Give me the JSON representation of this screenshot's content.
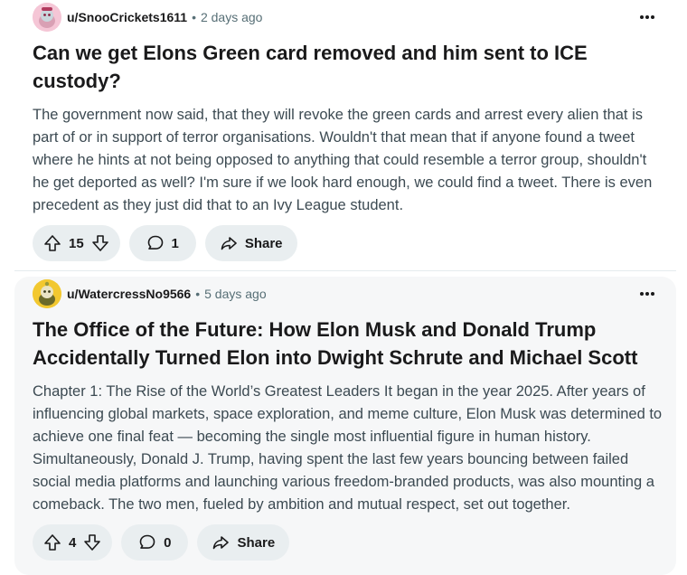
{
  "posts": [
    {
      "username": "u/SnooCrickets1611",
      "separator": "•",
      "time": "2 days ago",
      "title": "Can we get Elons Green card removed and him sent to ICE custody?",
      "body": "The government now said, that they will revoke the green cards and arrest every alien that is part of or in support of terror organisations. Wouldn't that mean that if anyone found a tweet where he hints at not being opposed to anything that could resemble a terror group, shouldn't he get deported as well? I'm sure if we look hard enough, we could find a tweet. There is even precedent as they just did that to an Ivy League student.",
      "votes": "15",
      "comments": "1",
      "share_label": "Share",
      "avatar_color": "#f5c6d6"
    },
    {
      "username": "u/WatercressNo9566",
      "separator": "•",
      "time": "5 days ago",
      "title": "The Office of the Future: How Elon Musk and Donald Trump Accidentally Turned Elon into Dwight Schrute and Michael Scott",
      "body": "Chapter 1: The Rise of the World’s Greatest Leaders It began in the year 2025. After years of influencing global markets, space exploration, and meme culture, Elon Musk was determined to achieve one final feat — becoming the single most influential figure in human history. Simultaneously, Donald J. Trump, having spent the last few years bouncing between failed social media platforms and launching various freedom-branded products, was also mounting a comeback. The two men, fueled by ambition and mutual respect, set out together.",
      "votes": "4",
      "comments": "0",
      "share_label": "Share",
      "avatar_color": "#f2c830"
    }
  ],
  "icons": [
    "upvote-icon",
    "downvote-icon",
    "comment-icon",
    "share-icon",
    "more-options-icon"
  ]
}
